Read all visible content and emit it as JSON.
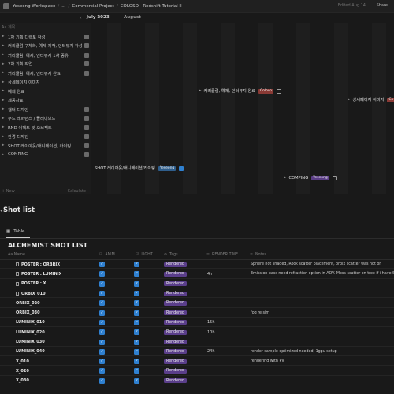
{
  "topbar": {
    "workspace": "Yeseong Workspace",
    "crumbs": [
      "Yeseong Workspace",
      "...",
      "Commercial Project",
      "COLOSO - Redshift Tutorial II"
    ],
    "edited": "Edited Aug 14",
    "share": "Share"
  },
  "timeline": {
    "months": [
      "July 2023",
      "August"
    ],
    "left_header": "Aa 제목",
    "tasks": [
      {
        "label": "1차 기획 디렉토 작성",
        "open": true
      },
      {
        "label": "커리큘럼 구체화, 예제 제작, 인터뷰지 작성",
        "open": true
      },
      {
        "label": "커리큘럼, 예제, 인터뷰지 1차 공유",
        "open": true
      },
      {
        "label": "2차 기획 작업",
        "open": true
      },
      {
        "label": "커리큘럼, 예제, 인터뷰지 완료",
        "open": true
      },
      {
        "label": "상세페이지 이미지",
        "open": false
      },
      {
        "label": "예제 완료",
        "open": false
      },
      {
        "label": "제공자료",
        "open": false
      },
      {
        "label": "챕터 디자인",
        "open": true
      },
      {
        "label": "무드 레퍼런스 / 플레이보드",
        "open": true
      },
      {
        "label": "RND 이펙트 및 오브젝트",
        "open": true
      },
      {
        "label": "환경 디자인",
        "open": true
      },
      {
        "label": "SHOT 레이아웃/애니메이션, 라이팅",
        "open": true
      },
      {
        "label": "COMPING",
        "open": true
      }
    ],
    "new_label": "+ New",
    "calc_label": "Calculate",
    "bars": {
      "b1": {
        "label": "커리큘럼, 예제, 인터뷰지 완료",
        "tag": "Coloso"
      },
      "b2": {
        "label": "상세페이지 이미지",
        "tag": "Co"
      },
      "b3": {
        "label": "SHOT 레이아웃/애니메이션/라이팅",
        "tag": "Yeseong"
      },
      "b4": {
        "label": "COMPING",
        "tag": "Yeseong"
      }
    }
  },
  "section": {
    "title": "Shot list",
    "view_tab": "Table",
    "db_title": "ALCHEMIST SHOT LIST"
  },
  "table": {
    "headers": [
      "Aa Name",
      "ANIM",
      "LIGHT",
      "Tags",
      "RENDER TIME",
      "Notes"
    ],
    "rows": [
      {
        "name": "POSTER : ORBRIX",
        "doc": true,
        "anim": true,
        "light": true,
        "tag": "Rendered",
        "time": "",
        "note": "Sphere not shaded, Rock scatter placement, orbix scatter was not on"
      },
      {
        "name": "POSTER : LUMINIX",
        "doc": true,
        "anim": true,
        "light": true,
        "tag": "Rendered",
        "time": "4h",
        "note": "Emission pass need refraction option in AOV. Moss scatter on tree if i have Sc"
      },
      {
        "name": "POSTER : X",
        "doc": true,
        "anim": true,
        "light": true,
        "tag": "Rendered",
        "time": "",
        "note": ""
      },
      {
        "name": "ORBIX_010",
        "doc": true,
        "anim": true,
        "light": true,
        "tag": "Rendered",
        "time": "",
        "note": ""
      },
      {
        "name": "ORBIX_020",
        "doc": false,
        "anim": true,
        "light": true,
        "tag": "Rendered",
        "time": "",
        "note": ""
      },
      {
        "name": "ORBIX_030",
        "doc": false,
        "anim": true,
        "light": true,
        "tag": "Rendered",
        "time": "",
        "note": "fog re sim"
      },
      {
        "name": "LUMINIX_010",
        "doc": false,
        "anim": true,
        "light": true,
        "tag": "Rendered",
        "time": "15h",
        "note": ""
      },
      {
        "name": "LUMINIX_020",
        "doc": false,
        "anim": true,
        "light": true,
        "tag": "Rendered",
        "time": "10h",
        "note": ""
      },
      {
        "name": "LUMINIX_030",
        "doc": false,
        "anim": true,
        "light": true,
        "tag": "Rendered",
        "time": "",
        "note": ""
      },
      {
        "name": "LUMINIX_040",
        "doc": false,
        "anim": true,
        "light": true,
        "tag": "Rendered",
        "time": "24h",
        "note": "render sample optimized needed, 1gpu setup"
      },
      {
        "name": "X_010",
        "doc": false,
        "anim": true,
        "light": true,
        "tag": "Rendered",
        "time": "",
        "note": "rendering with PV."
      },
      {
        "name": "X_020",
        "doc": false,
        "anim": true,
        "light": true,
        "tag": "Rendered",
        "time": "",
        "note": ""
      },
      {
        "name": "X_030",
        "doc": false,
        "anim": true,
        "light": true,
        "tag": "Rendered",
        "time": "",
        "note": ""
      }
    ]
  }
}
